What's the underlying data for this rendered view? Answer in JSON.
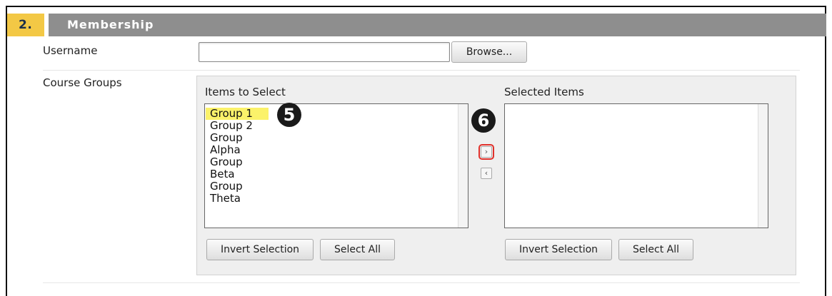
{
  "section": {
    "number": "2.",
    "title": "Membership"
  },
  "username": {
    "label": "Username",
    "value": "",
    "browse_label": "Browse..."
  },
  "course_groups": {
    "label": "Course Groups",
    "available": {
      "title": "Items to Select",
      "items": [
        {
          "label": "Group 1",
          "selected": true
        },
        {
          "label": "Group 2",
          "selected": false
        },
        {
          "label": "Group Alpha",
          "selected": false
        },
        {
          "label": "Group Beta",
          "selected": false
        },
        {
          "label": "Group Theta",
          "selected": false
        }
      ],
      "invert_label": "Invert Selection",
      "select_all_label": "Select All"
    },
    "move_right_icon": "chevron-right-icon",
    "move_left_icon": "chevron-left-icon",
    "selected": {
      "title": "Selected Items",
      "items": [],
      "invert_label": "Invert Selection",
      "select_all_label": "Select All"
    }
  },
  "callouts": {
    "step5": "5",
    "step6": "6"
  },
  "colors": {
    "step_badge": "#f3c845",
    "section_bar": "#8e8e8e",
    "selection_highlight": "#fbf26a",
    "focus_outline": "#e0312b"
  }
}
